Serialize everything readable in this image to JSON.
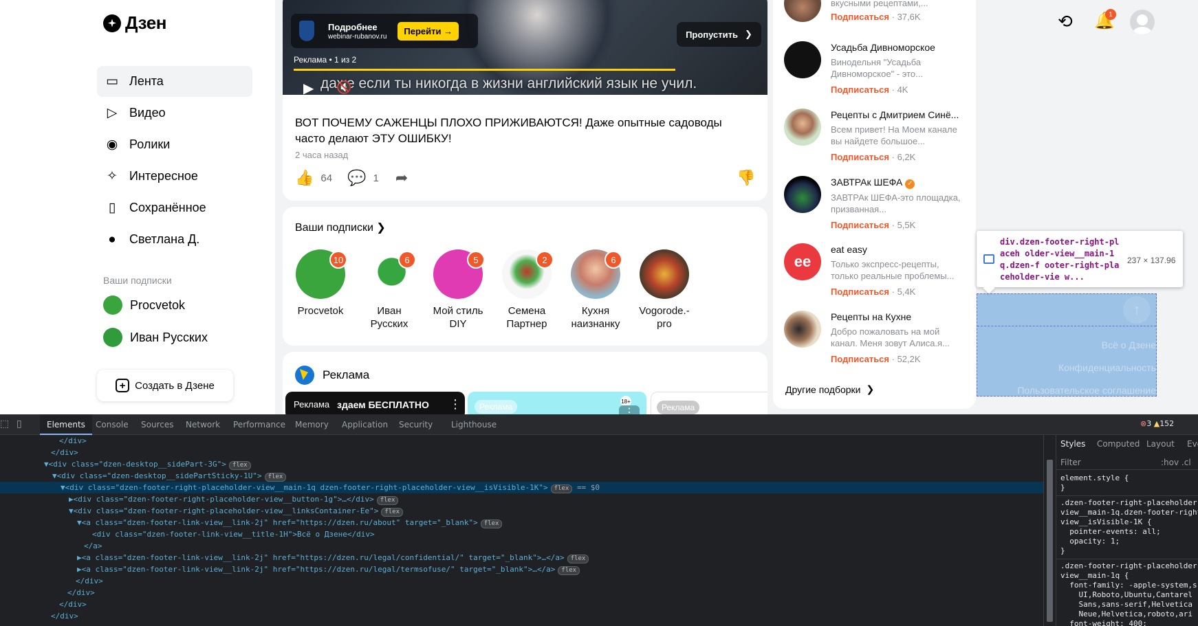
{
  "brand": {
    "logo_text": "Дзен"
  },
  "nav": {
    "items": [
      {
        "label": "Лента",
        "icon": "feed-icon"
      },
      {
        "label": "Видео",
        "icon": "play-icon"
      },
      {
        "label": "Ролики",
        "icon": "shorts-icon"
      },
      {
        "label": "Интересное",
        "icon": "sparkle-icon"
      },
      {
        "label": "Сохранённое",
        "icon": "bookmark-icon"
      },
      {
        "label": "Светлана Д.",
        "icon": "avatar-icon"
      }
    ],
    "subs_title": "Ваши подписки",
    "subs": [
      {
        "label": "Procvetok"
      },
      {
        "label": "Иван Русских"
      }
    ],
    "create_label": "Создать в Дзене"
  },
  "video_ad": {
    "more_label": "Подробнее",
    "domain": "webinar-rubanov.ru",
    "go_label": "Перейти →",
    "skip_label": "Пропустить",
    "ad_counter": "Реклама • 1 из 2",
    "subtitle": "даже если ты никогда в жизни английский язык не учил."
  },
  "post": {
    "title": "ВОТ ПОЧЕМУ САЖЕНЦЫ ПЛОХО ПРИЖИВАЮТСЯ! Даже опытные садоводы часто делают ЭТУ ОШИБКУ!",
    "time": "2 часа назад",
    "likes": "64",
    "comments": "1"
  },
  "subscriptions": {
    "title": "Ваши подписки",
    "items": [
      {
        "name": "Procvetok",
        "badge": "10",
        "color": "#3aa53c"
      },
      {
        "name": "Иван Русских",
        "badge": "6",
        "color": "#2f9b3a"
      },
      {
        "name": "Мой стиль DIY",
        "badge": "5",
        "color": "#e13bb3"
      },
      {
        "name": "Семена Партнер",
        "badge": "2",
        "color": "#4caf50"
      },
      {
        "name": "Кухня наизнанку",
        "badge": "6",
        "color": "#c77d6a"
      },
      {
        "name": "Vogorode.-pro",
        "badge": "",
        "color": "#7a4b2b"
      }
    ]
  },
  "ads_block": {
    "title": "Реклама",
    "mini": [
      {
        "label": "Реклама",
        "text": "здаем БЕСПЛАТНО"
      },
      {
        "label": "Реклама",
        "text": "18+"
      },
      {
        "label": "Реклама",
        "text": ""
      }
    ]
  },
  "channels": {
    "items": [
      {
        "name": "",
        "desc": "вкусными рецептами,...",
        "sub_label": "Подписаться",
        "count": "· 37,6K",
        "color": "#6b4b3b"
      },
      {
        "name": "Усадьба Дивноморское",
        "desc": "Винодельня \"Усадьба Дивноморское\" - это...",
        "sub_label": "Подписаться",
        "count": "· 4K",
        "color": "#111"
      },
      {
        "name": "Рецепты с Дмитрием Синё...",
        "desc": "Всем привет! На Моем канале вы найдете большое...",
        "sub_label": "Подписаться",
        "count": "· 6,2K",
        "color": "#8fb48a"
      },
      {
        "name": "ЗАВТРАк ШЕФА",
        "desc": "ЗАВТРАк ШЕФА-это площадка, призванная...",
        "sub_label": "Подписаться",
        "count": "· 5,5K",
        "color": "#1e2a4a"
      },
      {
        "name": "eat easy",
        "desc": "Только экспресс-рецепты, только реальные проблемы...",
        "sub_label": "Подписаться",
        "count": "· 5,4K",
        "color": "#ea3a3f"
      },
      {
        "name": "Рецепты на Кухне",
        "desc": "Добро пожаловать на мой канал. Меня зовут Алиса.я...",
        "sub_label": "Подписаться",
        "count": "· 52,2K",
        "color": "#9a7256"
      }
    ],
    "other_label": "Другие подборки"
  },
  "header": {
    "notif_count": "1"
  },
  "inspector": {
    "tooltip_text": "div.dzen-footer-right-placeholder-view__main-1q.dzen-footer-right-placeholder-view__isVisible-1K",
    "tooltip_text_short": "div.dzen-footer-right-placeh older-view__main-1q.dzen-f ooter-right-placeholder-vie w...",
    "size": "237 × 137.96",
    "links": [
      "Всё о Дзене",
      "Конфиденциальность",
      "Пользовательское соглашение"
    ]
  },
  "devtools": {
    "tabs": [
      "Elements",
      "Console",
      "Sources",
      "Network",
      "Performance",
      "Memory",
      "Application",
      "Security",
      "Lighthouse"
    ],
    "errors": "3",
    "warnings": "152",
    "lines": [
      {
        "indent": 78,
        "html": "</div>"
      },
      {
        "indent": 66,
        "html": "</div>"
      },
      {
        "indent": 58,
        "html": "▼<div class=\"dzen-desktop__sidePart-3G\">"
      },
      {
        "indent": 70,
        "html": "▼<div class=\"dzen-desktop__sidePartSticky-1U\">"
      },
      {
        "indent": 82,
        "html": "▼<div class=\"dzen-footer-right-placeholder-view__main-1q dzen-footer-right-placeholder-view__isVisible-1K\">"
      },
      {
        "indent": 94,
        "html": "▶<div class=\"dzen-footer-right-placeholder-view__button-1g\">…</div>"
      },
      {
        "indent": 94,
        "html": "▼<div class=\"dzen-footer-right-placeholder-view__linksContainer-Ee\">"
      },
      {
        "indent": 106,
        "html": "▼<a class=\"dzen-footer-link-view__link-2j\" href=\"https://dzen.ru/about\" target=\"_blank\">"
      },
      {
        "indent": 122,
        "html": "<div class=\"dzen-footer-link-view__title-1H\">Всё о Дзене</div>"
      },
      {
        "indent": 110,
        "html": "</a>"
      },
      {
        "indent": 106,
        "html": "▶<a class=\"dzen-footer-link-view__link-2j\" href=\"https://dzen.ru/legal/confidential/\" target=\"_blank\">…</a>"
      },
      {
        "indent": 106,
        "html": "▶<a class=\"dzen-footer-link-view__link-2j\" href=\"https://dzen.ru/legal/termsofuse/\" target=\"_blank\">…</a>"
      },
      {
        "indent": 98,
        "html": "</div>"
      },
      {
        "indent": 86,
        "html": "</div>"
      },
      {
        "indent": 74,
        "html": "</div>"
      },
      {
        "indent": 62,
        "html": "</div>"
      }
    ],
    "selected_suffix": "== $0",
    "styles_tabs": [
      "Styles",
      "Computed",
      "Layout",
      "Eve"
    ],
    "filter_placeholder": "Filter",
    "filter_hint": ":hov .cl",
    "styles": [
      "element.style {\n}",
      ".dzen-footer-right-placeholder-\nview__main-1q.dzen-footer-right\nview__isVisible-1K {\n  pointer-events: all;\n  opacity: 1;\n}",
      ".dzen-footer-right-placeholder-\nview__main-1q {\n  font-family: -apple-system,s\n    UI,Roboto,Ubuntu,Cantarel\n    Sans,sans-serif,Helvetica\n    Neue,Helvetica,roboto,ari\n  font-weight: 400;"
    ]
  }
}
